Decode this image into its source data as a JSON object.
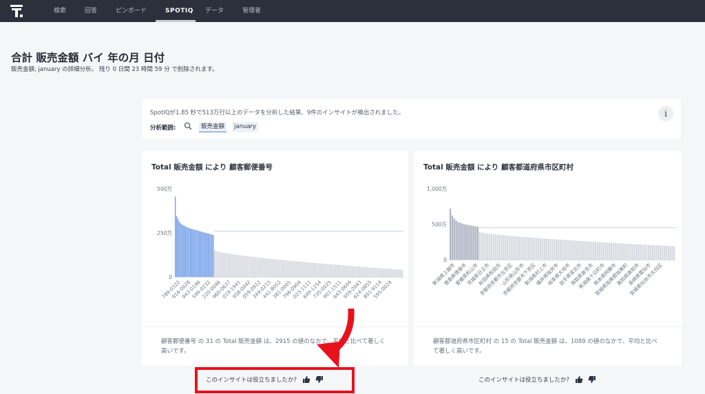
{
  "nav": {
    "logo_icon": "thoughtspot-logo-icon",
    "items": [
      {
        "label": "検索"
      },
      {
        "label": "回答"
      },
      {
        "label": "ピンボード"
      },
      {
        "label": "SPOTIQ"
      },
      {
        "label": "データ"
      },
      {
        "label": "管理者"
      }
    ],
    "active_index": 3
  },
  "page": {
    "title": "合計 販売金額 バイ 年の月 日付",
    "subtitle": "販売金額, january の詳細分析。 残り 0 日間 23 時間 59 分 で削除されます。"
  },
  "summary": {
    "text": "SpotIQが1.85 秒で513万行以上のデータを分析した結果、9件のインサイトが検出されました。",
    "scope_label": "分析範囲:",
    "search_icon": "search-icon",
    "chips": [
      "販売金額",
      "january"
    ],
    "info_label": "i"
  },
  "cards": [
    {
      "title": "Total 販売金額 により 顧客郵便番号",
      "description": "顧客郵便番号 の 31 の Total 販売金額 は、2915 の値のなかで、平均と比べて著しく高いです。",
      "feedback": {
        "question": "このインサイトは役立ちましたか?",
        "up_icon": "thumbs-up-icon",
        "down_icon": "thumbs-down-icon"
      }
    },
    {
      "title": "Total 販売金額 により 顧客都道府県市区町村",
      "description": "顧客都道府県市区町村 の 15 の Total 販売金額 は、1089 の値のなかで、平均と比べて著しく高いです。",
      "feedback": {
        "question": "このインサイトは役立ちましたか?",
        "up_icon": "thumbs-up-icon",
        "down_icon": "thumbs-down-icon"
      }
    }
  ],
  "chart_data": [
    {
      "type": "bar",
      "title": "Total 販売金額 により 顧客郵便番号",
      "xlabel": "",
      "ylabel": "",
      "ylim": [
        0,
        5000000
      ],
      "yticks": [
        "0",
        "250万",
        "500万"
      ],
      "categories": [
        "789-0322",
        "916-0028",
        "943-0146",
        "599-0232",
        "220-0046",
        "960-0637",
        "019-1941",
        "958-0042",
        "059-0912",
        "349-0215",
        "441-8052",
        "361-0001",
        "796-0904",
        "023-1111",
        "649-1254",
        "735-0025",
        "901-1511",
        "643-0604",
        "959-2043",
        "624-0855",
        "891-9114",
        "595-0024"
      ],
      "highlight_count": 31,
      "total_count": 2915,
      "highlight_color": "#6f9ce8",
      "base_color": "#d4d8de",
      "threshold": 2600000,
      "profile": {
        "highlight_values": [
          4550000,
          3450000,
          3300000,
          3150000,
          3050000,
          2990000,
          2940000,
          2900000,
          2860000,
          2830000,
          2800000,
          2770000,
          2740000,
          2720000,
          2700000,
          2680000,
          2660000,
          2640000,
          2620000,
          2600000,
          2580000,
          2560000,
          2540000,
          2520000,
          2500000,
          2480000,
          2460000,
          2440000,
          2420000,
          2400000,
          2380000
        ],
        "rest_start": 1500000,
        "rest_end": 400000
      }
    },
    {
      "type": "bar",
      "title": "Total 販売金額 により 顧客都道府県市区町村",
      "xlabel": "",
      "ylabel": "",
      "ylim": [
        0,
        10000000
      ],
      "yticks": [
        "0",
        "500万",
        "1,000万"
      ],
      "categories": [
        "新潟県上越市",
        "徳島県徳島市",
        "愛媛県松山市",
        "茨城県日立市",
        "秋田県秋田市",
        "京都府京都市左京区",
        "山形県山形市",
        "京都府京都市下京区",
        "新潟県村上市",
        "福井県坂井市",
        "岐阜県大垣市",
        "岩手県宮古市",
        "鳥取県倉吉市",
        "新潟県十日町市",
        "熊本県阿蘇市",
        "宮城県加美郡加美町",
        "高知県高知市",
        "長崎県雲仙市",
        "宮城県仙台市太白区"
      ],
      "highlight_count": 15,
      "total_count": 1089,
      "highlight_color": "#a9b0be",
      "base_color": "#d4d8de",
      "threshold": 4500000,
      "profile": {
        "highlight_values": [
          7200000,
          6200000,
          5800000,
          5500000,
          5300000,
          5200000,
          5100000,
          5000000,
          4950000,
          4900000,
          4850000,
          4800000,
          4750000,
          4700000,
          4650000
        ],
        "rest_start": 3900000,
        "rest_end": 1900000
      }
    }
  ]
}
